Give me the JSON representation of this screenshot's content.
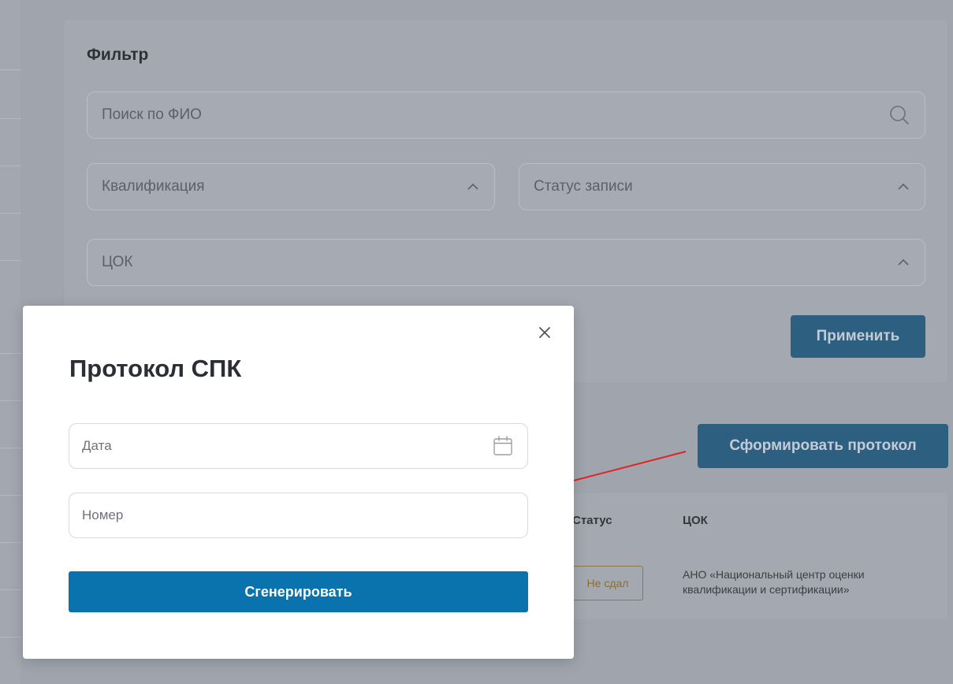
{
  "filter": {
    "title": "Фильтр",
    "search_placeholder": "Поиск по ФИО",
    "qualification_label": "Квалификация",
    "record_status_label": "Статус записи",
    "cok_label": "ЦОК",
    "apply_label": "Применить"
  },
  "actions": {
    "generate_protocol_label": "Сформировать протокол"
  },
  "table": {
    "columns": [
      "Статус",
      "ЦОК"
    ],
    "rows": [
      {
        "status": "Не сдал",
        "cok": "АНО «Национальный центр оценки квалификации и сертификации»"
      }
    ]
  },
  "modal": {
    "title": "Протокол СПК",
    "date_placeholder": "Дата",
    "number_placeholder": "Номер",
    "submit_label": "Сгенерировать"
  },
  "colors": {
    "primary": "#0a73ad",
    "overlay": "#a0a5ad",
    "arrow": "#e02424"
  }
}
